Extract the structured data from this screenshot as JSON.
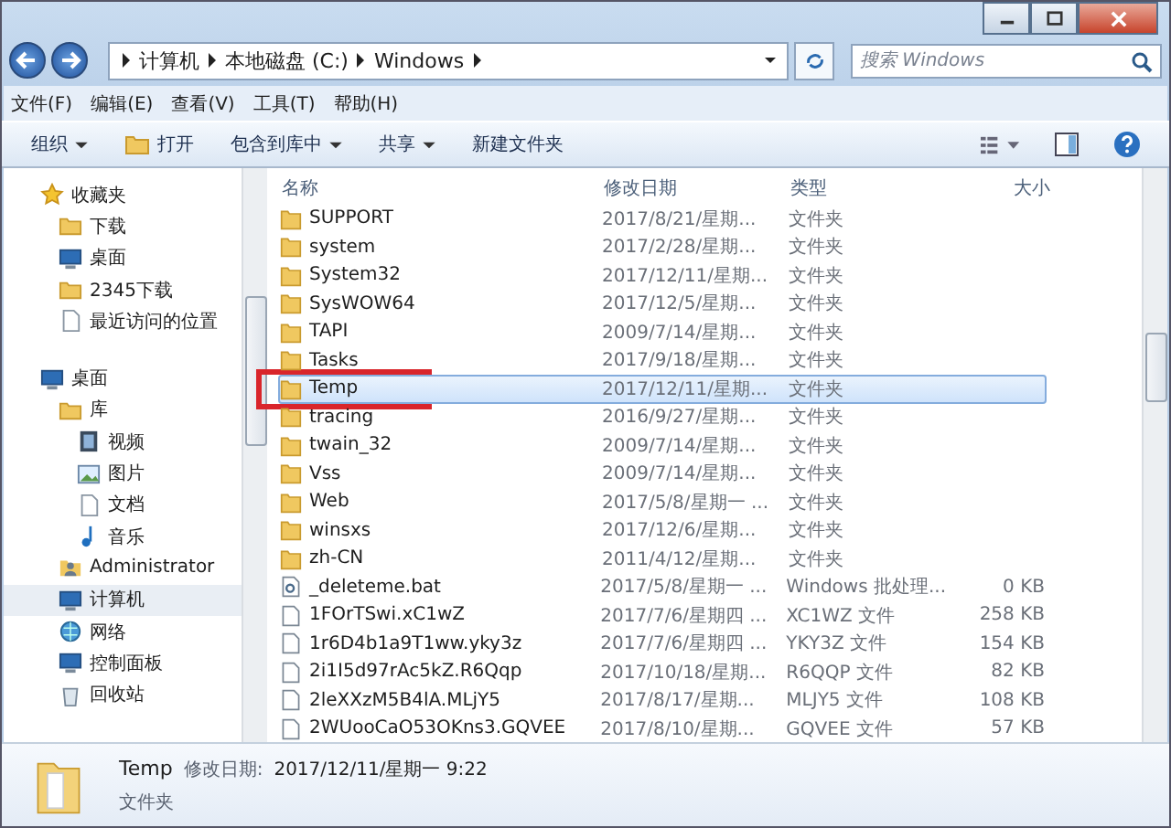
{
  "address": {
    "crumbs": [
      "计算机",
      "本地磁盘 (C:)",
      "Windows"
    ]
  },
  "search": {
    "placeholder": "搜索 Windows"
  },
  "menu": [
    "文件(F)",
    "编辑(E)",
    "查看(V)",
    "工具(T)",
    "帮助(H)"
  ],
  "toolbar": [
    {
      "label": "组织",
      "kind": "dropdown"
    },
    {
      "label": "打开",
      "kind": "open"
    },
    {
      "label": "包含到库中",
      "kind": "dropdown"
    },
    {
      "label": "共享",
      "kind": "dropdown"
    },
    {
      "label": "新建文件夹",
      "kind": "plain"
    }
  ],
  "sidebar": [
    {
      "label": "收藏夹",
      "kind": "star",
      "selected": false,
      "children": [
        {
          "label": "下载",
          "kind": "folder",
          "selected": false
        },
        {
          "label": "桌面",
          "kind": "monitor",
          "selected": false
        },
        {
          "label": "2345下载",
          "kind": "folder",
          "selected": false
        },
        {
          "label": "最近访问的位置",
          "kind": "doc",
          "selected": false
        }
      ]
    },
    {
      "label": "桌面",
      "kind": "monitor",
      "selected": false,
      "children": [
        {
          "label": "库",
          "kind": "folder",
          "selected": false,
          "children": [
            {
              "label": "视频",
              "kind": "film",
              "selected": false
            },
            {
              "label": "图片",
              "kind": "picture",
              "selected": false
            },
            {
              "label": "文档",
              "kind": "doc",
              "selected": false
            },
            {
              "label": "音乐",
              "kind": "music",
              "selected": false
            }
          ]
        },
        {
          "label": "Administrator",
          "kind": "user",
          "selected": false
        },
        {
          "label": "计算机",
          "kind": "monitor",
          "selected": true
        },
        {
          "label": "网络",
          "kind": "globe",
          "selected": false
        },
        {
          "label": "控制面板",
          "kind": "monitor",
          "selected": false
        },
        {
          "label": "回收站",
          "kind": "bin",
          "selected": false
        }
      ]
    }
  ],
  "table": {
    "columns": [
      "名称",
      "修改日期",
      "类型",
      "大小"
    ],
    "rows": [
      {
        "name": "SUPPORT",
        "date": "2017/8/21/星期...",
        "type": "文件夹",
        "size": "",
        "kind": "folder",
        "selected": false
      },
      {
        "name": "system",
        "date": "2017/2/28/星期...",
        "type": "文件夹",
        "size": "",
        "kind": "folder",
        "selected": false
      },
      {
        "name": "System32",
        "date": "2017/12/11/星期...",
        "type": "文件夹",
        "size": "",
        "kind": "folder",
        "selected": false
      },
      {
        "name": "SysWOW64",
        "date": "2017/12/5/星期...",
        "type": "文件夹",
        "size": "",
        "kind": "folder",
        "selected": false
      },
      {
        "name": "TAPI",
        "date": "2009/7/14/星期...",
        "type": "文件夹",
        "size": "",
        "kind": "folder",
        "selected": false
      },
      {
        "name": "Tasks",
        "date": "2017/9/18/星期...",
        "type": "文件夹",
        "size": "",
        "kind": "folder",
        "selected": false
      },
      {
        "name": "Temp",
        "date": "2017/12/11/星期...",
        "type": "文件夹",
        "size": "",
        "kind": "folder",
        "selected": true
      },
      {
        "name": "tracing",
        "date": "2016/9/27/星期...",
        "type": "文件夹",
        "size": "",
        "kind": "folder",
        "selected": false
      },
      {
        "name": "twain_32",
        "date": "2009/7/14/星期...",
        "type": "文件夹",
        "size": "",
        "kind": "folder",
        "selected": false
      },
      {
        "name": "Vss",
        "date": "2009/7/14/星期...",
        "type": "文件夹",
        "size": "",
        "kind": "folder",
        "selected": false
      },
      {
        "name": "Web",
        "date": "2017/5/8/星期一 ...",
        "type": "文件夹",
        "size": "",
        "kind": "folder",
        "selected": false
      },
      {
        "name": "winsxs",
        "date": "2017/12/6/星期...",
        "type": "文件夹",
        "size": "",
        "kind": "folder",
        "selected": false
      },
      {
        "name": "zh-CN",
        "date": "2011/4/12/星期...",
        "type": "文件夹",
        "size": "",
        "kind": "folder",
        "selected": false
      },
      {
        "name": "_deleteme.bat",
        "date": "2017/5/8/星期一 ...",
        "type": "Windows 批处理...",
        "size": "0 KB",
        "kind": "bat",
        "selected": false
      },
      {
        "name": "1FOrTSwi.xC1wZ",
        "date": "2017/7/6/星期四 ...",
        "type": "XC1WZ 文件",
        "size": "258 KB",
        "kind": "file",
        "selected": false
      },
      {
        "name": "1r6D4b1a9T1ww.yky3z",
        "date": "2017/7/6/星期四 ...",
        "type": "YKY3Z 文件",
        "size": "154 KB",
        "kind": "file",
        "selected": false
      },
      {
        "name": "2i1I5d97rAc5kZ.R6Qqp",
        "date": "2017/10/18/星期...",
        "type": "R6QQP 文件",
        "size": "82 KB",
        "kind": "file",
        "selected": false
      },
      {
        "name": "2leXXzM5B4lA.MLjY5",
        "date": "2017/8/17/星期...",
        "type": "MLJY5 文件",
        "size": "108 KB",
        "kind": "file",
        "selected": false
      },
      {
        "name": "2WUooCaO53OKns3.GQVEE",
        "date": "2017/8/10/星期...",
        "type": "GQVEE 文件",
        "size": "57 KB",
        "kind": "file",
        "selected": false
      }
    ]
  },
  "details": {
    "name": "Temp",
    "date_label": "修改日期:",
    "date": "2017/12/11/星期一 9:22",
    "type": "文件夹"
  }
}
